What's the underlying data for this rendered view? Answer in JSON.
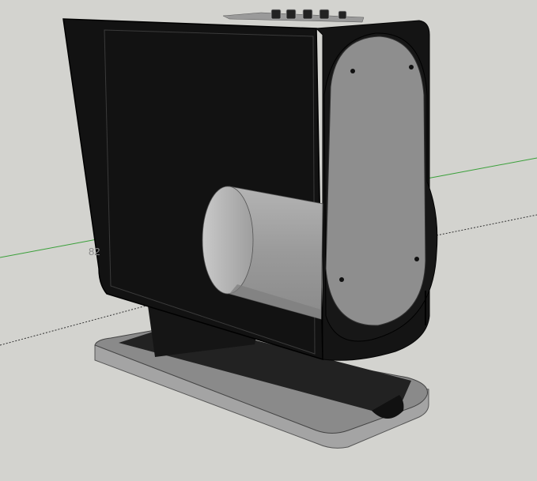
{
  "viewport": {
    "background": "#d3d3cf",
    "axis_green": "#3aa03a",
    "axis_dotted": "#333333"
  },
  "scene": {
    "dimension_label": "82",
    "colors": {
      "body_dark": "#141414",
      "body_edge": "#050505",
      "side_plate": "#8e8e8e",
      "cylinder": "#9c9c9c",
      "base_top": "#8a8a8a",
      "base_side": "#a4a4a4",
      "base_shadow": "#222222"
    }
  }
}
